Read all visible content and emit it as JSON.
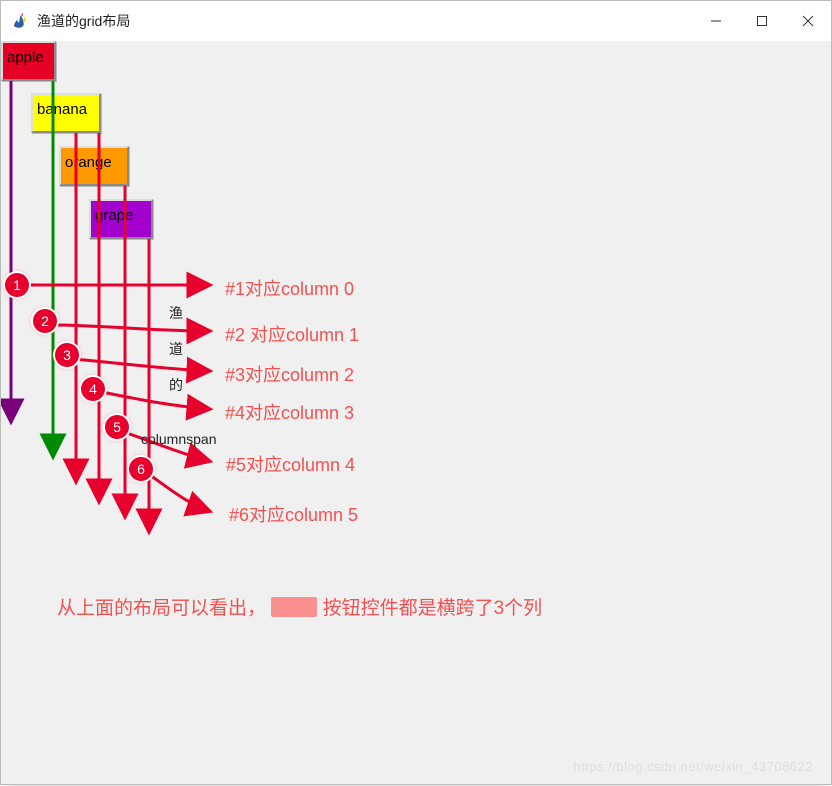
{
  "window": {
    "title": "渔道的grid布局"
  },
  "buttons": {
    "apple": {
      "label": "apple"
    },
    "banana": {
      "label": "banana"
    },
    "orange": {
      "label": "orange"
    },
    "grape": {
      "label": "grape"
    }
  },
  "markers": {
    "n1": "1",
    "n2": "2",
    "n3": "3",
    "n4": "4",
    "n5": "5",
    "n6": "6"
  },
  "annotations": {
    "c0": "#1对应column 0",
    "c1": "#2 对应column 1",
    "c2": "#3对应column 2",
    "c3": "#4对应column 3",
    "c4": "#5对应column 4",
    "c5": "#6对应column 5"
  },
  "sideLabels": {
    "yu": "渔",
    "dao": "道",
    "de": "的",
    "cs": "columnspan"
  },
  "footer": {
    "pre": "从上面的布局可以看出，",
    "post": "按钮控件都是横跨了3个列"
  },
  "watermark": "https://blog.csdn.net/weixin_43708622"
}
